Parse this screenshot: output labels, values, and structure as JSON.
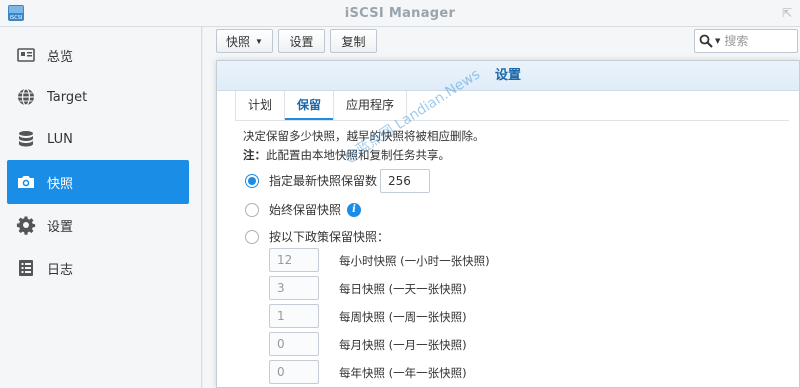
{
  "window": {
    "title": "iSCSI Manager",
    "app_icon_label": "iSCSI"
  },
  "sidebar": {
    "items": [
      {
        "label": "总览",
        "icon": "overview-icon"
      },
      {
        "label": "Target",
        "icon": "globe-icon"
      },
      {
        "label": "LUN",
        "icon": "database-icon"
      },
      {
        "label": "快照",
        "icon": "camera-icon",
        "active": true
      },
      {
        "label": "设置",
        "icon": "gear-icon"
      },
      {
        "label": "日志",
        "icon": "log-icon"
      }
    ]
  },
  "toolbar": {
    "snapshot_label": "快照",
    "settings_label": "设置",
    "replicate_label": "复制",
    "search_placeholder": "搜索"
  },
  "dialog": {
    "title": "设置",
    "tabs": [
      {
        "label": "计划"
      },
      {
        "label": "保留",
        "active": true
      },
      {
        "label": "应用程序"
      }
    ],
    "desc_line1": "决定保留多少快照，越早的快照将被相应删除。",
    "note_prefix": "注：",
    "note_text": "此配置由本地快照和复制任务共享。",
    "options": {
      "latest_label": "指定最新快照保留数",
      "latest_value": "256",
      "always_label": "始终保留快照",
      "policy_label": "按以下政策保留快照："
    },
    "policies": [
      {
        "value": "12",
        "label": "每小时快照 (一小时一张快照)"
      },
      {
        "value": "3",
        "label": "每日快照 (一天一张快照)"
      },
      {
        "value": "1",
        "label": "每周快照 (一周一张快照)"
      },
      {
        "value": "0",
        "label": "每月快照 (一月一张快照)"
      },
      {
        "value": "0",
        "label": "每年快照 (一年一张快照)"
      }
    ]
  },
  "watermark": "@蓝点网 Landian.News",
  "colors": {
    "accent": "#1a8de6",
    "header_text": "#1a66a8"
  }
}
